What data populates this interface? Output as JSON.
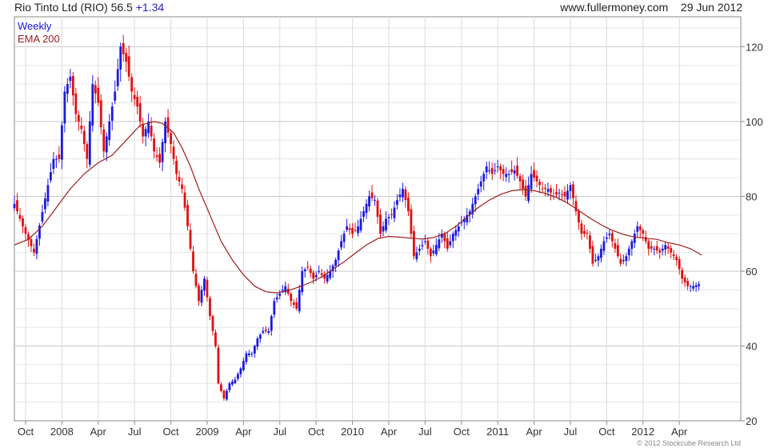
{
  "header": {
    "title": "Rio Tinto Ltd (RIO)",
    "price": "56.5",
    "change": "+1.34",
    "site": "www.fullermoney.com",
    "date": "29 Jun 2012"
  },
  "footer": {
    "copyright": "© 2012 Stockcube Research Ltd"
  },
  "colors": {
    "up": "#1a1adf",
    "down": "#e01010",
    "ema": "#a01c1c",
    "grid": "#d6d6d6",
    "frame": "#8a8a8a"
  },
  "chart_data": {
    "type": "candlestick",
    "title": "Rio Tinto Ltd (RIO) 56.5 +1.34",
    "legend": [
      "Weekly",
      "EMA 200"
    ],
    "legend_position": "top-left",
    "grid": true,
    "ylim": [
      20,
      128
    ],
    "y_ticks": [
      20,
      40,
      60,
      80,
      100,
      120
    ],
    "x_ticks": [
      "Oct",
      "2008",
      "Apr",
      "Jul",
      "Oct",
      "2009",
      "Apr",
      "Jul",
      "Oct",
      "2010",
      "Apr",
      "Jul",
      "Oct",
      "2011",
      "Apr",
      "Jul",
      "Oct",
      "2012",
      "Apr"
    ],
    "x_range": [
      0,
      260
    ],
    "price_path": [
      [
        0,
        78
      ],
      [
        4,
        70
      ],
      [
        7,
        65
      ],
      [
        12,
        83
      ],
      [
        14,
        90
      ],
      [
        16,
        90
      ],
      [
        18,
        108
      ],
      [
        20,
        112
      ],
      [
        22,
        102
      ],
      [
        24,
        98
      ],
      [
        26,
        90
      ],
      [
        28,
        110
      ],
      [
        30,
        105
      ],
      [
        32,
        92
      ],
      [
        34,
        100
      ],
      [
        36,
        108
      ],
      [
        38,
        120
      ],
      [
        40,
        116
      ],
      [
        42,
        108
      ],
      [
        44,
        104
      ],
      [
        46,
        96
      ],
      [
        48,
        100
      ],
      [
        50,
        92
      ],
      [
        52,
        89
      ],
      [
        54,
        100
      ],
      [
        56,
        94
      ],
      [
        58,
        86
      ],
      [
        60,
        82
      ],
      [
        62,
        72
      ],
      [
        64,
        60
      ],
      [
        66,
        52
      ],
      [
        68,
        58
      ],
      [
        70,
        48
      ],
      [
        72,
        40
      ],
      [
        73,
        30
      ],
      [
        75,
        26
      ],
      [
        77,
        30
      ],
      [
        79,
        31
      ],
      [
        81,
        34
      ],
      [
        83,
        38
      ],
      [
        85,
        38
      ],
      [
        87,
        42
      ],
      [
        89,
        44
      ],
      [
        91,
        44
      ],
      [
        93,
        52
      ],
      [
        95,
        54
      ],
      [
        97,
        56
      ],
      [
        99,
        52
      ],
      [
        101,
        50
      ],
      [
        103,
        60
      ],
      [
        105,
        61
      ],
      [
        107,
        58
      ],
      [
        109,
        60
      ],
      [
        111,
        58
      ],
      [
        113,
        60
      ],
      [
        115,
        63
      ],
      [
        117,
        68
      ],
      [
        119,
        72
      ],
      [
        121,
        70
      ],
      [
        123,
        72
      ],
      [
        125,
        76
      ],
      [
        127,
        80
      ],
      [
        129,
        79
      ],
      [
        131,
        70
      ],
      [
        133,
        74
      ],
      [
        135,
        75
      ],
      [
        137,
        79
      ],
      [
        139,
        82
      ],
      [
        141,
        76
      ],
      [
        143,
        64
      ],
      [
        145,
        66
      ],
      [
        147,
        68
      ],
      [
        149,
        64
      ],
      [
        151,
        67
      ],
      [
        153,
        70
      ],
      [
        155,
        66
      ],
      [
        157,
        70
      ],
      [
        159,
        72
      ],
      [
        161,
        74
      ],
      [
        163,
        76
      ],
      [
        165,
        80
      ],
      [
        167,
        84
      ],
      [
        169,
        88
      ],
      [
        171,
        86
      ],
      [
        173,
        88
      ],
      [
        175,
        86
      ],
      [
        177,
        86
      ],
      [
        179,
        87
      ],
      [
        181,
        84
      ],
      [
        183,
        80
      ],
      [
        185,
        86
      ],
      [
        187,
        84
      ],
      [
        189,
        82
      ],
      [
        191,
        82
      ],
      [
        193,
        80
      ],
      [
        195,
        81
      ],
      [
        197,
        80
      ],
      [
        199,
        83
      ],
      [
        201,
        76
      ],
      [
        203,
        70
      ],
      [
        205,
        70
      ],
      [
        207,
        62
      ],
      [
        209,
        64
      ],
      [
        211,
        68
      ],
      [
        213,
        70
      ],
      [
        215,
        66
      ],
      [
        217,
        62
      ],
      [
        219,
        64
      ],
      [
        221,
        68
      ],
      [
        223,
        72
      ],
      [
        225,
        70
      ],
      [
        227,
        66
      ],
      [
        229,
        66
      ],
      [
        231,
        65
      ],
      [
        233,
        67
      ],
      [
        235,
        65
      ],
      [
        237,
        63
      ],
      [
        239,
        58
      ],
      [
        241,
        56
      ],
      [
        243,
        56
      ],
      [
        245,
        56.5
      ]
    ],
    "ema200": [
      [
        0,
        67
      ],
      [
        5,
        68.5
      ],
      [
        10,
        72
      ],
      [
        15,
        77
      ],
      [
        20,
        82
      ],
      [
        25,
        86
      ],
      [
        30,
        89
      ],
      [
        35,
        91
      ],
      [
        40,
        95
      ],
      [
        45,
        99
      ],
      [
        50,
        100
      ],
      [
        53,
        99.5
      ],
      [
        57,
        97
      ],
      [
        60,
        93
      ],
      [
        63,
        88
      ],
      [
        66,
        82
      ],
      [
        70,
        75
      ],
      [
        74,
        68
      ],
      [
        78,
        63
      ],
      [
        82,
        59
      ],
      [
        86,
        56
      ],
      [
        90,
        54.5
      ],
      [
        94,
        54.2
      ],
      [
        98,
        54.8
      ],
      [
        102,
        55.8
      ],
      [
        106,
        57
      ],
      [
        110,
        58.5
      ],
      [
        114,
        60.5
      ],
      [
        118,
        62.5
      ],
      [
        122,
        64.8
      ],
      [
        126,
        67
      ],
      [
        130,
        68.7
      ],
      [
        134,
        69.3
      ],
      [
        138,
        69.1
      ],
      [
        142,
        68.8
      ],
      [
        146,
        68.6
      ],
      [
        150,
        69
      ],
      [
        154,
        70
      ],
      [
        158,
        72
      ],
      [
        162,
        74.5
      ],
      [
        166,
        77
      ],
      [
        170,
        79
      ],
      [
        174,
        80.5
      ],
      [
        178,
        81.5
      ],
      [
        182,
        81.8
      ],
      [
        186,
        81.5
      ],
      [
        190,
        80.8
      ],
      [
        194,
        79.7
      ],
      [
        198,
        78.2
      ],
      [
        202,
        76.2
      ],
      [
        206,
        74.2
      ],
      [
        210,
        72.4
      ],
      [
        214,
        70.9
      ],
      [
        218,
        69.8
      ],
      [
        222,
        69.1
      ],
      [
        226,
        68.8
      ],
      [
        230,
        68.5
      ],
      [
        234,
        67.6
      ],
      [
        238,
        67
      ],
      [
        242,
        66
      ],
      [
        246,
        64.3
      ]
    ]
  }
}
